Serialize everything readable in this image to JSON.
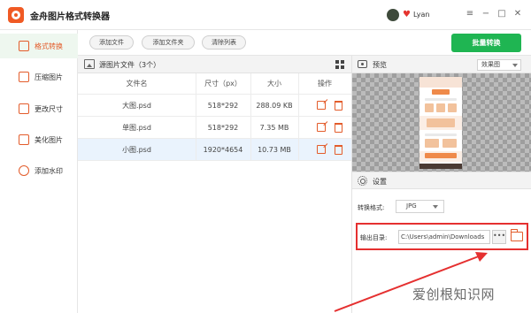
{
  "app": {
    "title": "金舟图片格式转换器",
    "user": "Lyan"
  },
  "window_controls": {
    "menu": "≡",
    "minimize": "−",
    "maximize": "□",
    "close": "✕"
  },
  "sidebar": {
    "items": [
      {
        "label": "格式转换",
        "icon": "convert-icon",
        "active": true
      },
      {
        "label": "压缩图片",
        "icon": "compress-icon",
        "active": false
      },
      {
        "label": "更改尺寸",
        "icon": "resize-icon",
        "active": false
      },
      {
        "label": "美化图片",
        "icon": "beautify-icon",
        "active": false
      },
      {
        "label": "添加水印",
        "icon": "watermark-icon",
        "active": false
      }
    ]
  },
  "toolbar": {
    "add_file": "添加文件",
    "add_folder": "添加文件夹",
    "clear_list": "清除列表",
    "batch_convert": "批量转换"
  },
  "file_list": {
    "title": "源图片文件（3个）",
    "columns": [
      "文件名",
      "尺寸（px）",
      "大小",
      "操作"
    ],
    "rows": [
      {
        "name": "大图.psd",
        "size_px": "518*292",
        "size": "288.09 KB",
        "selected": false
      },
      {
        "name": "单图.psd",
        "size_px": "518*292",
        "size": "7.35 MB",
        "selected": false
      },
      {
        "name": "小图.psd",
        "size_px": "1920*4654",
        "size": "10.73 MB",
        "selected": true
      }
    ]
  },
  "preview": {
    "title": "预览",
    "mode": "效果图"
  },
  "settings": {
    "title": "设置",
    "format_label": "转换格式:",
    "format_value": "JPG",
    "output_label": "输出目录:",
    "output_path": "C:\\Users\\admin\\Downloads",
    "browse_label": "•••"
  },
  "annotation": {
    "color": "#e53030"
  },
  "watermark_text": "爱创根知识网",
  "colors": {
    "accent": "#e35c2b",
    "primary_button": "#1fb552",
    "selected_row": "#eaf3fd",
    "highlight": "#e53030"
  }
}
